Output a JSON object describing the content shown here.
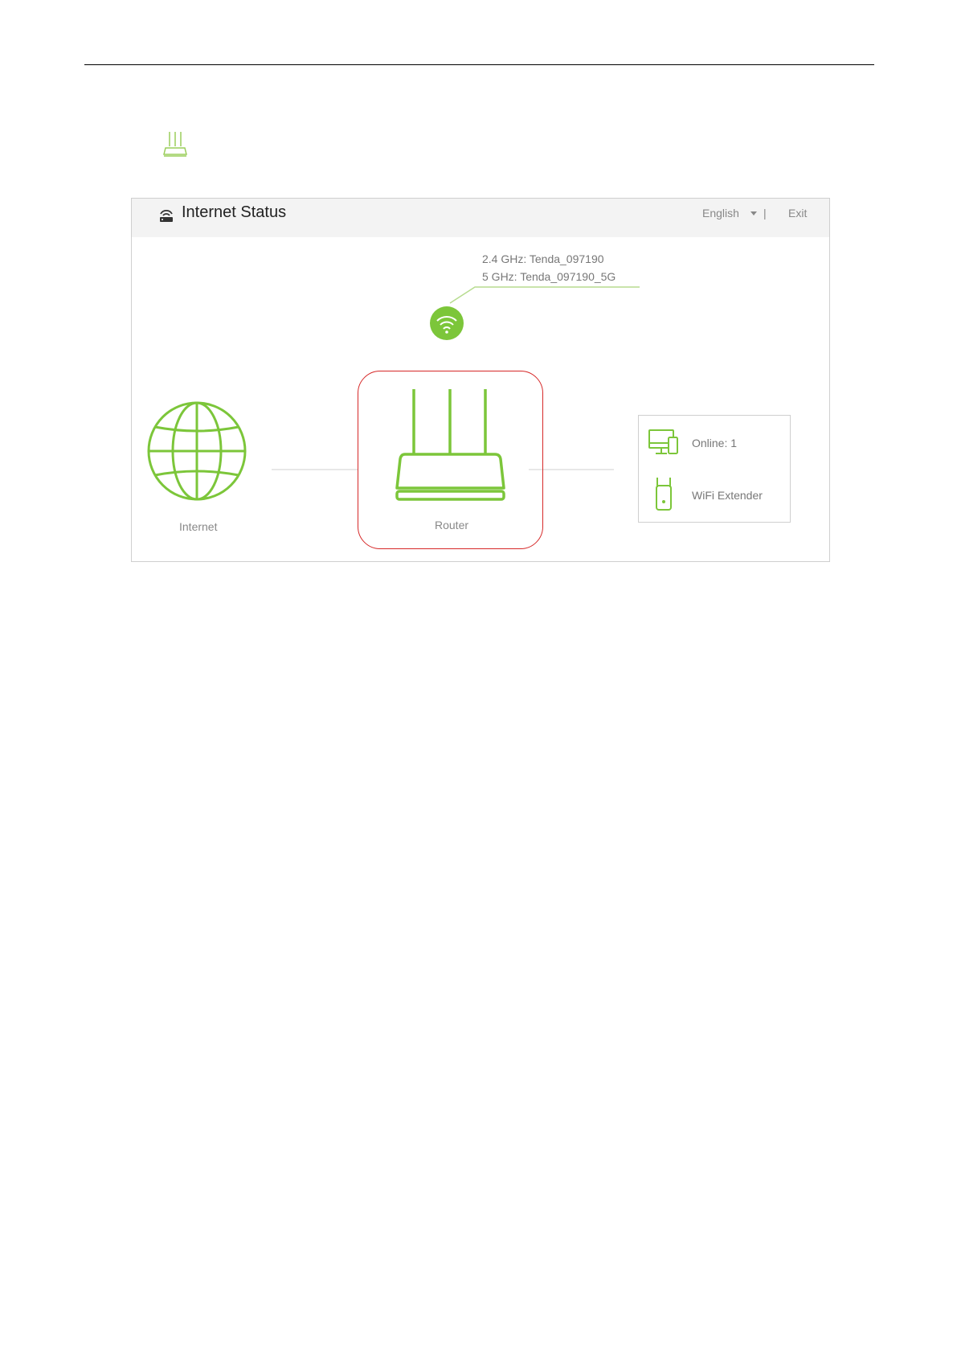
{
  "header": {
    "title": "Internet Status",
    "language": "English",
    "separator": "|",
    "exit": "Exit"
  },
  "wifi": {
    "ssid_24": "2.4 GHz: Tenda_097190",
    "ssid_5": "5 GHz: Tenda_097190_5G"
  },
  "nodes": {
    "internet_label": "Internet",
    "router_label": "Router"
  },
  "clients": {
    "online_label": "Online:  1",
    "extender_label": "WiFi Extender"
  },
  "colors": {
    "accent_green": "#7cc63a",
    "highlight_red": "#d62828",
    "header_bg": "#f3f3f3"
  },
  "icons": {
    "small_router": "router-icon",
    "header": "router-signal-icon",
    "wifi": "wifi-icon",
    "internet": "globe-icon",
    "router": "router-icon",
    "devices": "devices-icon",
    "extender": "extender-icon"
  }
}
